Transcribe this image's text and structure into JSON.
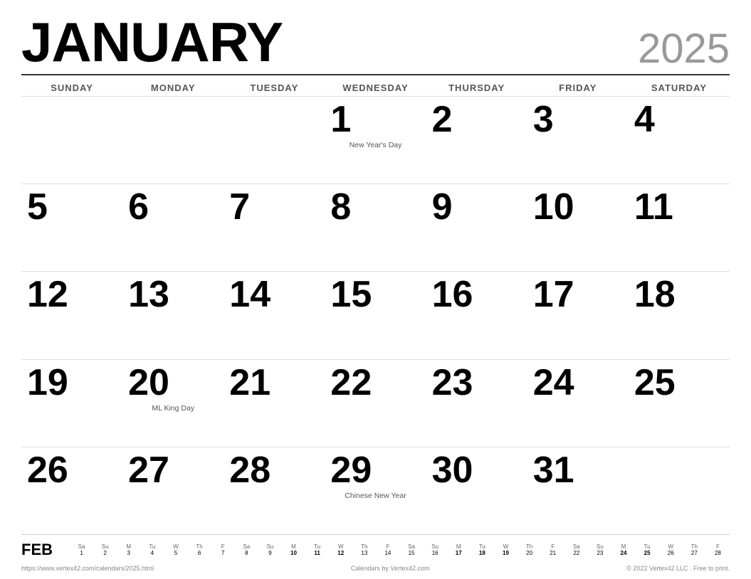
{
  "header": {
    "month": "JANUARY",
    "year": "2025"
  },
  "day_headers": [
    "SUNDAY",
    "MONDAY",
    "TUESDAY",
    "WEDNESDAY",
    "THURSDAY",
    "FRIDAY",
    "SATURDAY"
  ],
  "weeks": [
    [
      {
        "num": "",
        "event": ""
      },
      {
        "num": "",
        "event": ""
      },
      {
        "num": "",
        "event": ""
      },
      {
        "num": "1",
        "event": "New Year's Day"
      },
      {
        "num": "2",
        "event": ""
      },
      {
        "num": "3",
        "event": ""
      },
      {
        "num": "4",
        "event": ""
      }
    ],
    [
      {
        "num": "5",
        "event": ""
      },
      {
        "num": "6",
        "event": ""
      },
      {
        "num": "7",
        "event": ""
      },
      {
        "num": "8",
        "event": ""
      },
      {
        "num": "9",
        "event": ""
      },
      {
        "num": "10",
        "event": ""
      },
      {
        "num": "11",
        "event": ""
      }
    ],
    [
      {
        "num": "12",
        "event": ""
      },
      {
        "num": "13",
        "event": ""
      },
      {
        "num": "14",
        "event": ""
      },
      {
        "num": "15",
        "event": ""
      },
      {
        "num": "16",
        "event": ""
      },
      {
        "num": "17",
        "event": ""
      },
      {
        "num": "18",
        "event": ""
      }
    ],
    [
      {
        "num": "19",
        "event": ""
      },
      {
        "num": "20",
        "event": "ML King Day"
      },
      {
        "num": "21",
        "event": ""
      },
      {
        "num": "22",
        "event": ""
      },
      {
        "num": "23",
        "event": ""
      },
      {
        "num": "24",
        "event": ""
      },
      {
        "num": "25",
        "event": ""
      }
    ],
    [
      {
        "num": "26",
        "event": ""
      },
      {
        "num": "27",
        "event": ""
      },
      {
        "num": "28",
        "event": ""
      },
      {
        "num": "29",
        "event": "Chinese New Year"
      },
      {
        "num": "30",
        "event": ""
      },
      {
        "num": "31",
        "event": ""
      },
      {
        "num": "",
        "event": ""
      }
    ]
  ],
  "mini": {
    "label": "FEB",
    "headers": [
      "Sa",
      "Su",
      "M",
      "Tu",
      "W",
      "Th",
      "F",
      "Sa",
      "Su",
      "M",
      "Tu",
      "W",
      "Th",
      "F",
      "Sa",
      "Su",
      "M",
      "Tu",
      "W",
      "Th",
      "F",
      "Sa",
      "Su",
      "M",
      "Tu",
      "W",
      "Th",
      "F"
    ],
    "nums": [
      "1",
      "2",
      "3",
      "4",
      "5",
      "6",
      "7",
      "8",
      "9",
      "10",
      "11",
      "12",
      "13",
      "14",
      "15",
      "16",
      "17",
      "18",
      "19",
      "20",
      "21",
      "22",
      "23",
      "24",
      "25",
      "26",
      "27",
      "28"
    ],
    "bold": [
      10,
      11,
      12,
      17,
      18,
      19,
      24,
      25
    ]
  },
  "footer": {
    "url": "https://www.vertex42.com/calendars/2025.html",
    "center": "Calendars by Vertex42.com",
    "copyright": "© 2022 Vertex42 LLC . Free to print."
  }
}
